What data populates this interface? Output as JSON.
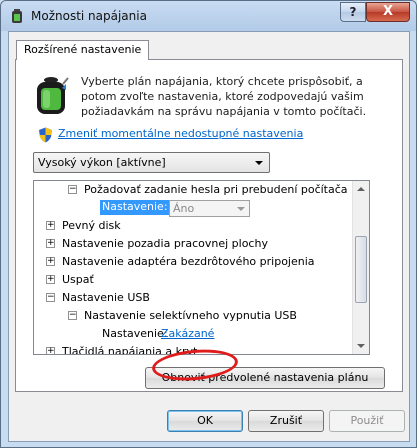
{
  "window": {
    "title": "Možnosti napájania",
    "help_label": "?",
    "close_label": "X"
  },
  "tab": {
    "label": "Rozšírené nastavenie"
  },
  "description": "Vyberte plán napájania, ktorý chcete prispôsobiť, a potom zvoľte nastavenia, ktoré zodpovedajú vašim požiadavkám na správu napájania v tomto počítači.",
  "change_link": "Zmeniť momentálne nedostupné nastavenia",
  "plan_select": {
    "value": "Vysoký výkon [aktívne]"
  },
  "tree": {
    "rows": [
      {
        "label": "Požadovať zadanie hesla pri prebudení počítača",
        "expander": "−"
      },
      {
        "label": "Pevný disk",
        "expander": "+"
      },
      {
        "label": "Nastavenie pozadia pracovnej plochy",
        "expander": "+"
      },
      {
        "label": "Nastavenie adaptéra bezdrôtového pripojenia",
        "expander": "+"
      },
      {
        "label": "Uspať",
        "expander": "+"
      },
      {
        "label": "Nastavenie USB",
        "expander": "−"
      },
      {
        "label": "Nastavenie selektívneho vypnutia USB",
        "expander": "−"
      },
      {
        "label": "Tlačidlá napájania a kryt",
        "expander": "+"
      }
    ],
    "password_setting": {
      "label": "Nastavenie:",
      "value": "Áno"
    },
    "usb_setting": {
      "label": "Nastavenie:",
      "value": "Zakázané"
    }
  },
  "buttons": {
    "restore": "Obnoviť predvolené nastavenia plánu",
    "ok": "OK",
    "cancel": "Zrušiť",
    "apply": "Použiť"
  },
  "colors": {
    "selection": "#3399ff",
    "link": "#0066cc",
    "annotation": "#e01b1b"
  }
}
